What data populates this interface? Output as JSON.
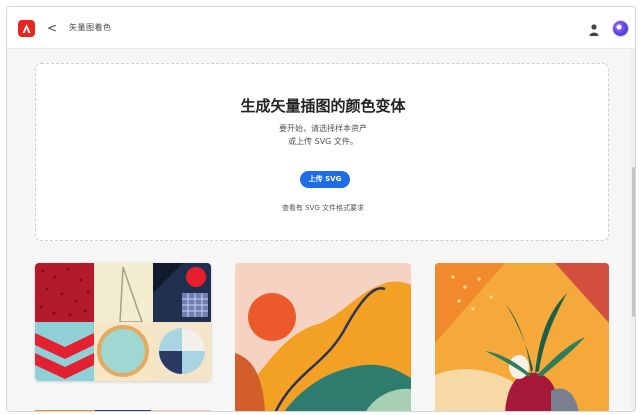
{
  "header": {
    "back_symbol": "<",
    "breadcrumb": "矢量图着色"
  },
  "upload_card": {
    "title": "生成矢量插图的颜色变体",
    "description_line1": "要开始，请选择样本资产",
    "description_line2": "或上传 SVG 文件。",
    "upload_button_label": "上传 SVG",
    "requirements_link": "查看有 SVG 文件格式要求"
  },
  "samples": [
    {
      "name": "geometric-patterns"
    },
    {
      "name": "abstract-landscape"
    },
    {
      "name": "plant-pot"
    }
  ],
  "icons": {
    "app_logo": "adobe-express-logo-icon",
    "back": "chevron-left-icon",
    "user": "user-icon",
    "avatar": "avatar"
  },
  "colors": {
    "accent": "#1d6ee6",
    "brand": "#e8251f"
  }
}
